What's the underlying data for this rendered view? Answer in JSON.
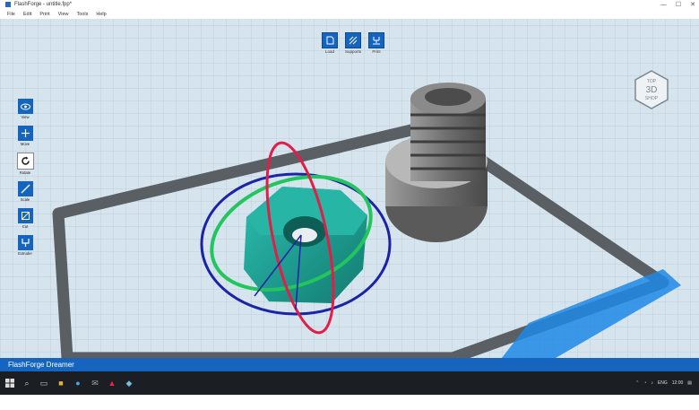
{
  "window": {
    "title": "FlashForge - untitle.fpp*",
    "controls": [
      "—",
      "☐",
      "✕"
    ]
  },
  "menu": [
    "File",
    "Edit",
    "Print",
    "View",
    "Tools",
    "Help"
  ],
  "toolbar": [
    {
      "label": "Load",
      "icon": "load-icon"
    },
    {
      "label": "Supports",
      "icon": "supports-icon"
    },
    {
      "label": "Print",
      "icon": "print-icon"
    }
  ],
  "left_tools": [
    {
      "label": "View",
      "icon": "eye-icon"
    },
    {
      "label": "Move",
      "icon": "move-icon"
    },
    {
      "label": "Rotate",
      "icon": "rotate-icon"
    },
    {
      "label": "Scale",
      "icon": "scale-icon"
    },
    {
      "label": "Cut",
      "icon": "cut-icon"
    },
    {
      "label": "Extruder",
      "icon": "extruder-icon"
    }
  ],
  "logo": {
    "line1": "TOP",
    "line2": "3D",
    "line3": "SHOP"
  },
  "status": {
    "text": "FlashForge Dreamer"
  },
  "taskbar": {
    "lang": "ENG",
    "time": "12:00"
  },
  "colors": {
    "accent": "#1565c0",
    "nut": "#1fa69a",
    "grid_bg": "#d6e4ee",
    "taskbar": "#1b1f24"
  }
}
